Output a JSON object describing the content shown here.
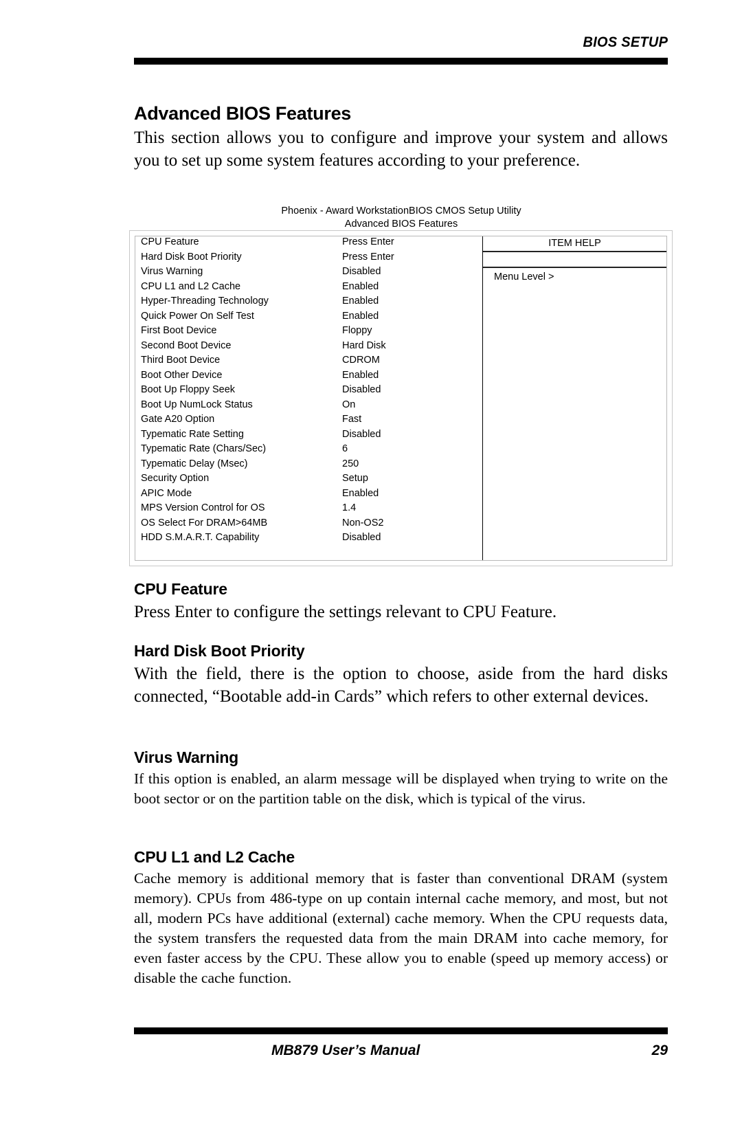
{
  "header": {
    "section": "BIOS SETUP"
  },
  "page": {
    "title": "Advanced BIOS Features",
    "intro": "This section allows you to configure and improve your system and allows you to set up some system features according to your preference."
  },
  "bios_screen": {
    "caption_line1": "Phoenix - Award WorkstationBIOS CMOS Setup Utility",
    "caption_line2": "Advanced BIOS Features",
    "settings": [
      {
        "label": "CPU Feature",
        "value": "Press Enter"
      },
      {
        "label": "Hard Disk Boot Priority",
        "value": "Press Enter"
      },
      {
        "label": "Virus Warning",
        "value": "Disabled"
      },
      {
        "label": "CPU L1 and L2 Cache",
        "value": "Enabled"
      },
      {
        "label": "Hyper-Threading Technology",
        "value": "Enabled"
      },
      {
        "label": "Quick Power On Self Test",
        "value": "Enabled"
      },
      {
        "label": "First Boot Device",
        "value": "Floppy"
      },
      {
        "label": "Second Boot Device",
        "value": "Hard Disk"
      },
      {
        "label": "Third Boot Device",
        "value": "CDROM"
      },
      {
        "label": "Boot Other Device",
        "value": "Enabled"
      },
      {
        "label": "Boot Up Floppy Seek",
        "value": "Disabled"
      },
      {
        "label": "Boot Up NumLock Status",
        "value": "On"
      },
      {
        "label": "Gate A20 Option",
        "value": "Fast"
      },
      {
        "label": "Typematic Rate Setting",
        "value": "Disabled"
      },
      {
        "label": "Typematic Rate (Chars/Sec)",
        "value": "6"
      },
      {
        "label": "Typematic Delay (Msec)",
        "value": "250"
      },
      {
        "label": "Security Option",
        "value": "Setup"
      },
      {
        "label": "APIC Mode",
        "value": "Enabled"
      },
      {
        "label": "MPS Version Control for OS",
        "value": "1.4"
      },
      {
        "label": "OS Select For DRAM>64MB",
        "value": "Non-OS2"
      },
      {
        "label": "HDD S.M.A.R.T. Capability",
        "value": "Disabled"
      }
    ],
    "help": {
      "title": "ITEM HELP",
      "menu_level": "Menu Level  >"
    }
  },
  "sections": [
    {
      "heading": "CPU Feature",
      "text": "Press Enter to configure the settings relevant to CPU Feature."
    },
    {
      "heading": "Hard Disk Boot Priority",
      "text": "With the field, there is the option to choose, aside from the hard disks connected,  “Bootable add-in Cards” which refers to other external devices."
    },
    {
      "heading": "Virus Warning",
      "text": "If this option is enabled, an alarm message will be displayed when trying to write on the boot sector or on the partition table on the disk, which is typical of the virus."
    },
    {
      "heading": "CPU L1 and L2 Cache",
      "text": "Cache memory is additional memory that is faster than conventional DRAM (system memory). CPUs from 486-type on up contain internal cache memory, and most, but not all, modern PCs have additional (external) cache memory. When the CPU requests data, the system transfers the requested data from the main DRAM into cache memory, for even faster access by the CPU. These allow you to enable (speed up memory access) or disable the cache function."
    }
  ],
  "footer": {
    "manual": "MB879 User’s Manual",
    "page_number": "29"
  }
}
